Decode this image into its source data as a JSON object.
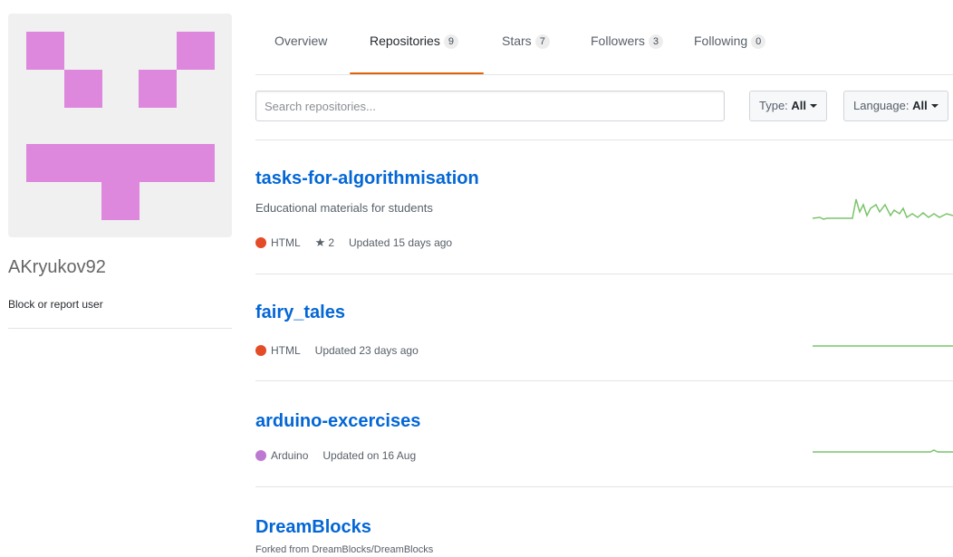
{
  "profile": {
    "username": "AKryukov92",
    "block_label": "Block or report user",
    "avatar_color": "#dd88dd"
  },
  "tabs": [
    {
      "label": "Overview",
      "count": null
    },
    {
      "label": "Repositories",
      "count": "9"
    },
    {
      "label": "Stars",
      "count": "7"
    },
    {
      "label": "Followers",
      "count": "3"
    },
    {
      "label": "Following",
      "count": "0"
    }
  ],
  "search": {
    "placeholder": "Search repositories...",
    "type_label": "Type:",
    "type_value": "All",
    "language_label": "Language:",
    "language_value": "All"
  },
  "repos": [
    {
      "name": "tasks-for-algorithmisation",
      "description": "Educational materials for students",
      "language": "HTML",
      "language_color": "#e34c26",
      "stars": "2",
      "updated": "Updated 15 days ago"
    },
    {
      "name": "fairy_tales",
      "language": "HTML",
      "language_color": "#e34c26",
      "updated": "Updated 23 days ago"
    },
    {
      "name": "arduino-excercises",
      "language": "Arduino",
      "language_color": "#bd79d1",
      "updated": "Updated on 16 Aug"
    },
    {
      "name": "DreamBlocks",
      "forked_from": "Forked from DreamBlocks/DreamBlocks"
    }
  ],
  "colors": {
    "link": "#0366d6",
    "tab_accent": "#e36209",
    "sparkline": "#7ac46b"
  }
}
